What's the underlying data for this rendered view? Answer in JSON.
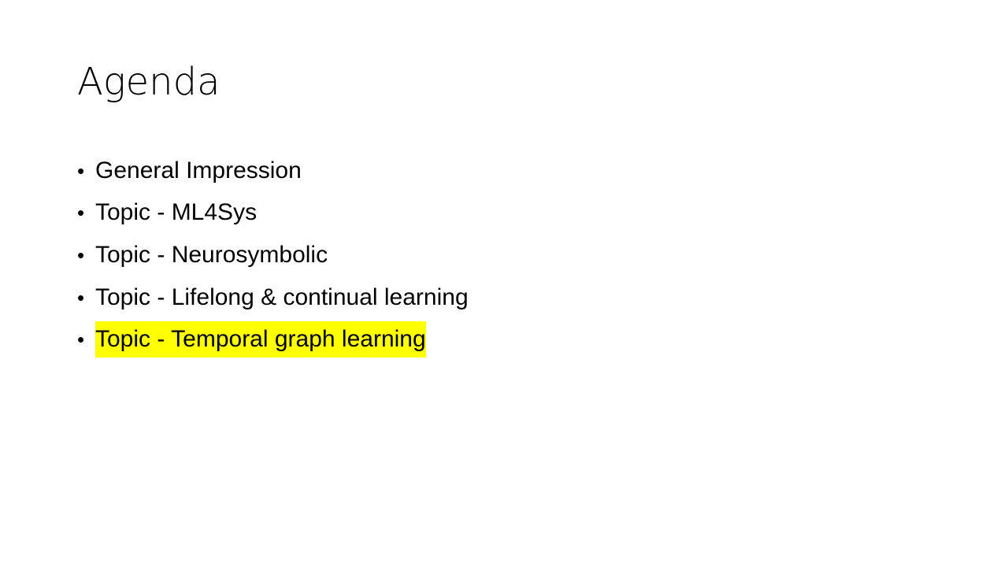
{
  "slide": {
    "title": "Agenda",
    "items": [
      {
        "text": "General Impression",
        "highlight": false
      },
      {
        "text": "Topic - ML4Sys",
        "highlight": false
      },
      {
        "text": "Topic - Neurosymbolic",
        "highlight": false
      },
      {
        "text": "Topic - Lifelong & continual learning",
        "highlight": false
      },
      {
        "text": "Topic - Temporal graph learning",
        "highlight": true
      }
    ],
    "bullet_symbol": "•",
    "highlight_color": "#ffff00"
  }
}
